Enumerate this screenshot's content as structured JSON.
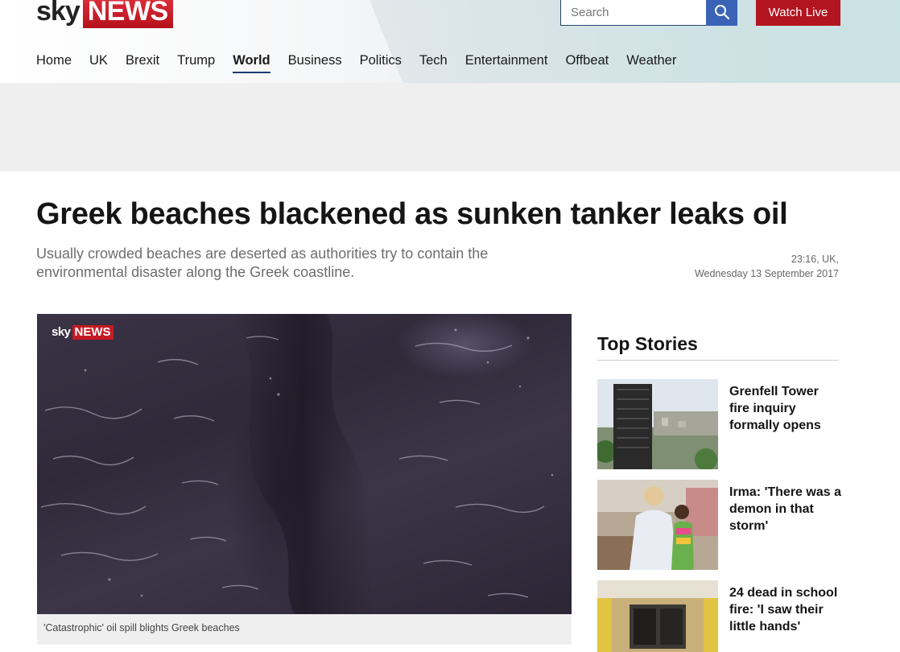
{
  "header": {
    "logo_sky": "sky",
    "logo_news": "NEWS",
    "search_placeholder": "Search",
    "watch_live": "Watch Live",
    "nav": [
      {
        "label": "Home",
        "active": false
      },
      {
        "label": "UK",
        "active": false
      },
      {
        "label": "Brexit",
        "active": false
      },
      {
        "label": "Trump",
        "active": false
      },
      {
        "label": "World",
        "active": true
      },
      {
        "label": "Business",
        "active": false
      },
      {
        "label": "Politics",
        "active": false
      },
      {
        "label": "Tech",
        "active": false
      },
      {
        "label": "Entertainment",
        "active": false
      },
      {
        "label": "Offbeat",
        "active": false
      },
      {
        "label": "Weather",
        "active": false
      }
    ]
  },
  "article": {
    "headline": "Greek beaches blackened as sunken tanker leaks oil",
    "standfirst": "Usually crowded beaches are deserted as authorities try to contain the environmental disaster along the Greek coastline.",
    "time": "23:16, UK,",
    "date": "Wednesday 13 September 2017",
    "video_logo_sky": "sky",
    "video_logo_news": "NEWS",
    "caption": "'Catastrophic' oil spill blights Greek beaches"
  },
  "top_stories": {
    "title": "Top Stories",
    "items": [
      {
        "title": "Grenfell Tower fire inquiry formally opens"
      },
      {
        "title": "Irma: 'There was a demon in that storm'"
      },
      {
        "title": "24 dead in school fire: 'I saw their little hands'"
      }
    ]
  },
  "colors": {
    "brand_red": "#b2151f",
    "search_blue": "#3a63b7",
    "nav_underline": "#1c3b6e"
  }
}
